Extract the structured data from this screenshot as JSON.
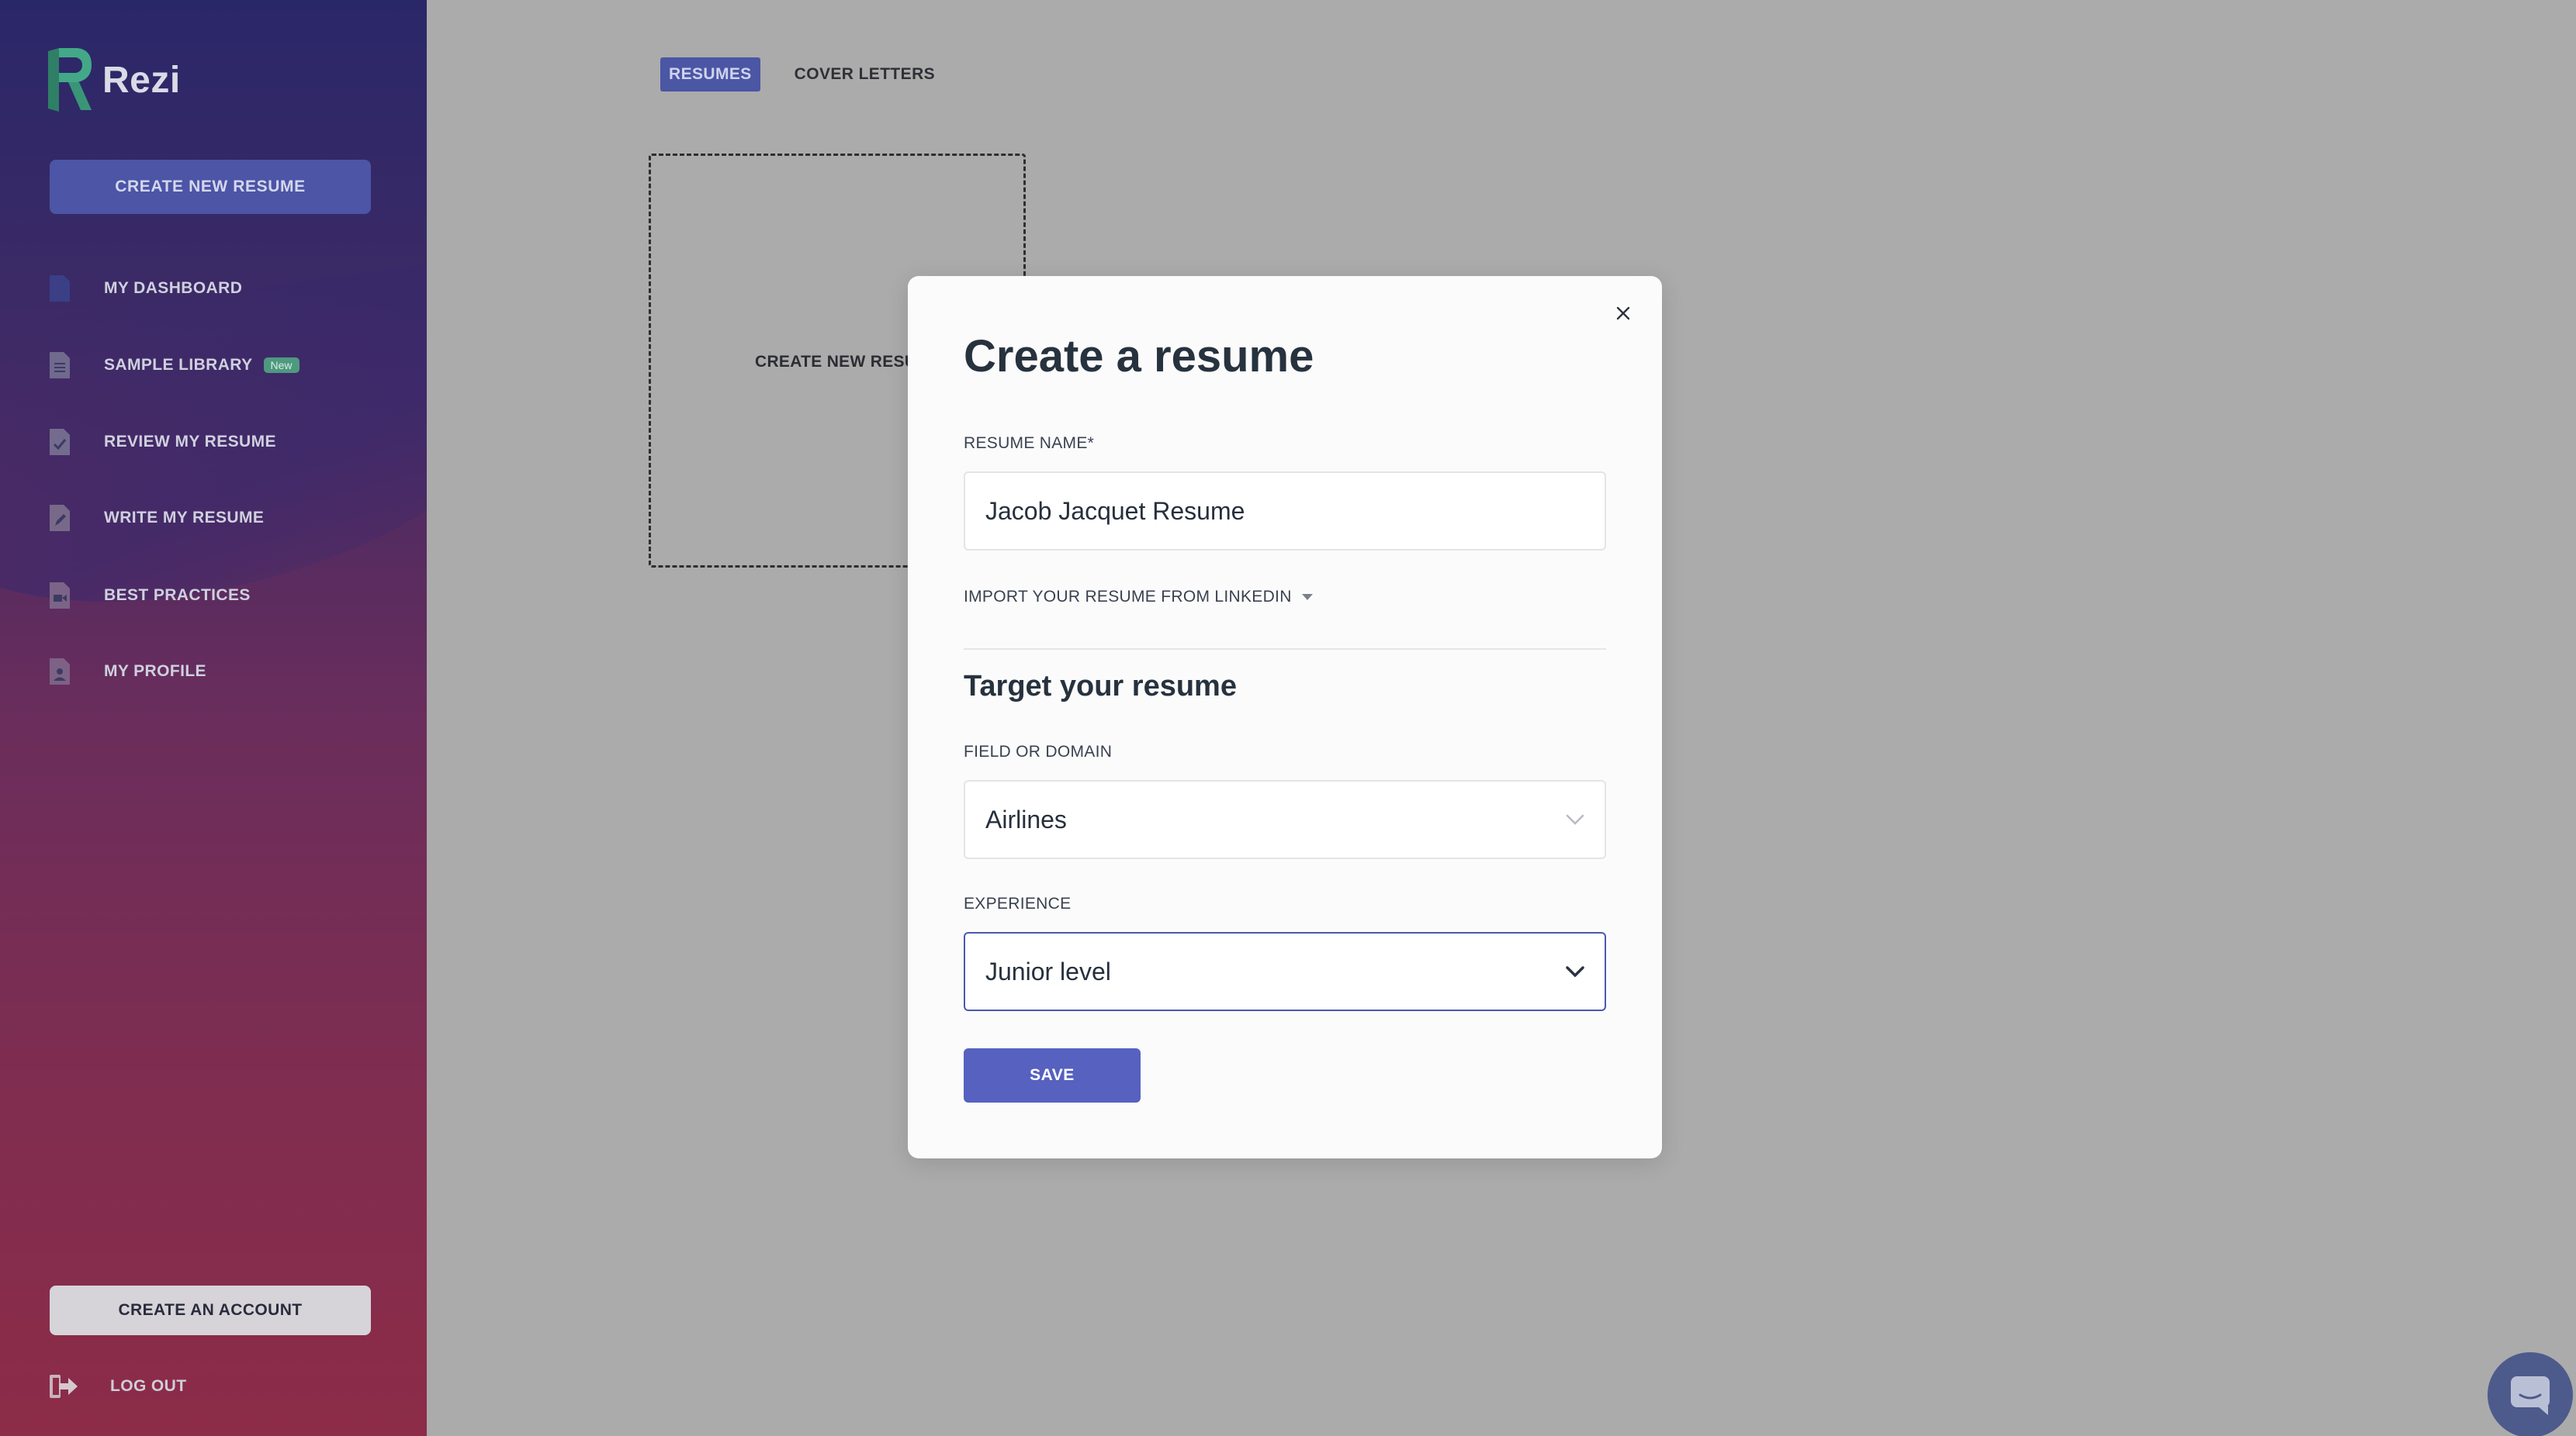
{
  "app": {
    "name": "Rezi"
  },
  "sidebar": {
    "create_new_resume": "CREATE NEW RESUME",
    "items": [
      {
        "label": "MY DASHBOARD",
        "icon": "document-icon"
      },
      {
        "label": "SAMPLE LIBRARY",
        "icon": "document-list-icon",
        "badge": "New"
      },
      {
        "label": "REVIEW MY RESUME",
        "icon": "document-check-icon"
      },
      {
        "label": "WRITE MY RESUME",
        "icon": "document-pencil-icon"
      },
      {
        "label": "BEST PRACTICES",
        "icon": "document-video-icon"
      },
      {
        "label": "MY PROFILE",
        "icon": "document-user-icon"
      }
    ],
    "create_account": "CREATE AN ACCOUNT",
    "logout": "LOG OUT"
  },
  "main": {
    "tabs": [
      {
        "label": "RESUMES",
        "active": true
      },
      {
        "label": "COVER LETTERS",
        "active": false
      }
    ],
    "new_card_label": "CREATE NEW RESUME"
  },
  "modal": {
    "title": "Create a resume",
    "resume_name_label": "RESUME NAME*",
    "resume_name_value": "Jacob Jacquet Resume",
    "import_label": "IMPORT YOUR RESUME FROM LINKEDIN",
    "section_title": "Target your resume",
    "field_label": "FIELD OR DOMAIN",
    "field_value": "Airlines",
    "experience_label": "EXPERIENCE",
    "experience_value": "Junior level",
    "save_label": "SAVE"
  },
  "colors": {
    "accent": "#5661c0",
    "sidebar_top": "#2a2768",
    "sidebar_bottom": "#8c2c48",
    "overlay": "#ababab",
    "badge_new": "#4e9a7e",
    "logo_green": "#3fa07e"
  }
}
